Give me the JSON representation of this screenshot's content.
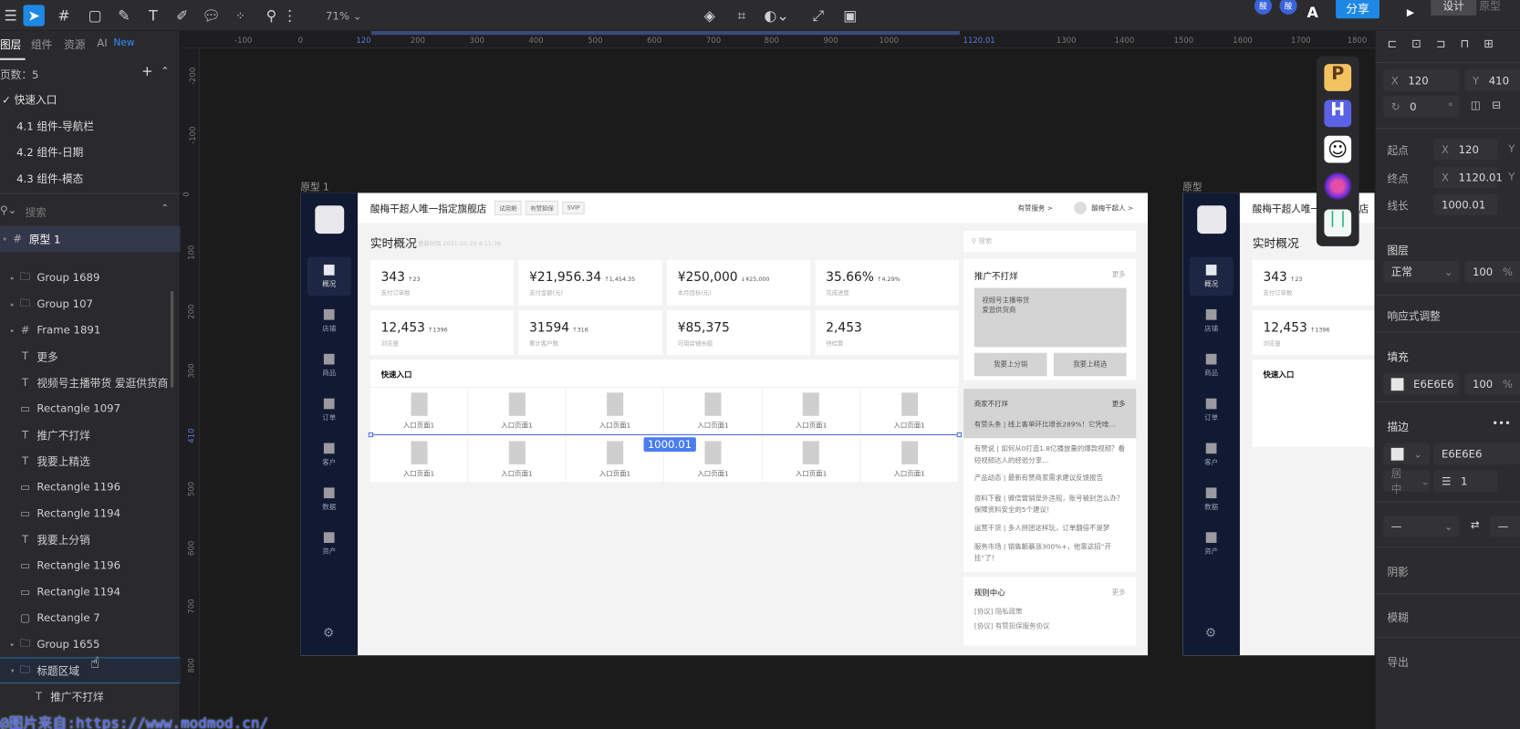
{
  "toolbar": {
    "zoom": "71%",
    "avatars": [
      "酸",
      "酸"
    ],
    "share_label": "分享",
    "mode_design": "设计",
    "mode_prototype": "原型",
    "accent": "#1e88e5"
  },
  "left_panel": {
    "tabs": [
      "图层",
      "组件",
      "资源",
      "AI"
    ],
    "ai_badge": "New",
    "pages_count_label": "页数：5",
    "pages": [
      "快速入口",
      "4.1 组件-导航栏",
      "4.2 组件-日期",
      "4.3 组件-模态"
    ],
    "search_placeholder": "搜索",
    "root_frame": "原型 1",
    "layers": [
      {
        "name": "Group 1689",
        "type": "group",
        "caret": true,
        "indent": 1
      },
      {
        "name": "Group 107",
        "type": "group",
        "caret": true,
        "indent": 1
      },
      {
        "name": "Frame 1891",
        "type": "frame",
        "caret": true,
        "indent": 1
      },
      {
        "name": "更多",
        "type": "text",
        "indent": 1
      },
      {
        "name": "视频号主播带货 爱逛供货商",
        "type": "text",
        "indent": 1
      },
      {
        "name": "Rectangle 1097",
        "type": "rect",
        "indent": 1
      },
      {
        "name": "推广不打烊",
        "type": "text",
        "indent": 1
      },
      {
        "name": "我要上精选",
        "type": "text",
        "indent": 1
      },
      {
        "name": "Rectangle 1196",
        "type": "rect",
        "indent": 1
      },
      {
        "name": "Rectangle 1194",
        "type": "rect",
        "indent": 1
      },
      {
        "name": "我要上分销",
        "type": "text",
        "indent": 1
      },
      {
        "name": "Rectangle 1196",
        "type": "rect",
        "indent": 1
      },
      {
        "name": "Rectangle 1194",
        "type": "rect",
        "indent": 1
      },
      {
        "name": "Rectangle 7",
        "type": "square",
        "indent": 1
      },
      {
        "name": "Group 1655",
        "type": "group",
        "caret": true,
        "indent": 1
      },
      {
        "name": "标题区域",
        "type": "group",
        "caret": true,
        "open": true,
        "indent": 1
      },
      {
        "name": "推广不打烊",
        "type": "text",
        "indent": 2
      }
    ]
  },
  "rulers": {
    "horizontal": [
      "-100",
      "0",
      "120",
      "200",
      "300",
      "400",
      "500",
      "600",
      "700",
      "800",
      "900",
      "1000",
      "1120.01",
      "1300",
      "1400",
      "1500",
      "1600",
      "1700",
      "1800"
    ],
    "vertical": [
      "-200",
      "-100",
      "0",
      "100",
      "200",
      "300",
      "410",
      "500",
      "600",
      "700",
      "800"
    ]
  },
  "canvas": {
    "frame1_label": "原型 1",
    "frame2_label": "原型",
    "measure_label": "1000.01",
    "store_name": "酸梅干超人唯一指定旗舰店",
    "tags": [
      "试用期",
      "有赞担保",
      "SVIP"
    ],
    "service_link": "有赞服务 >",
    "user_name": "酸梅干超人 >",
    "nav": [
      "概况",
      "店铺",
      "商品",
      "订单",
      "客户",
      "数据",
      "资产"
    ],
    "overview_title": "实时概况",
    "update_time": "更新时间 2021-10-20 4:11:36",
    "stats": [
      {
        "value": "343",
        "delta": "↑23",
        "label": "支付订单数"
      },
      {
        "value": "¥21,956.34",
        "delta": "↑1,454.35",
        "label": "支付金额(元)"
      },
      {
        "value": "¥250,000",
        "delta": "↓¥25,000",
        "label": "本月目标(元)"
      },
      {
        "value": "35.66%",
        "delta": "↑4.29%",
        "label": "完成进度"
      },
      {
        "value": "12,453",
        "delta": "↑1396",
        "label": "浏览量"
      },
      {
        "value": "31594",
        "delta": "↑316",
        "label": "累计客户数"
      },
      {
        "value": "¥85,375",
        "delta": "",
        "label": "可用店铺余额"
      },
      {
        "value": "2,453",
        "delta": "",
        "label": "待结算"
      }
    ],
    "quick_entry_title": "快速入口",
    "entries": [
      "入口页面1",
      "入口页面1",
      "入口页面1",
      "入口页面1",
      "入口页面1",
      "入口页面1",
      "入口页面1",
      "入口页面1",
      "入口页面1",
      "入口页面1",
      "入口页面1",
      "入口页面1"
    ],
    "search_placeholder": "搜索",
    "promo": {
      "title": "推广不打烊",
      "more": "更多",
      "banner_line1": "视频号主播带货",
      "banner_line2": "爱逛供货商",
      "btn1": "我要上分销",
      "btn2": "我要上精选"
    },
    "merchant": {
      "title": "商家不打烊",
      "more": "更多",
      "items": [
        "有赞头条 | 线上客单环比增长289%！它凭啥…",
        "有赞说 | 如何从0打造1.8亿播放量的爆款视频？看短视频达人的经验分享…",
        "产品动态 | 最新有赞商家需求建议反馈报告",
        "资料下载 | 微信营销是外违规，账号被封怎么办？保障资料安全的5个建议！",
        "运营干货 | 多人拼团这样玩，订单翻倍不是梦",
        "服务市场 | 销售额暴涨300%+，他靠这招“开挂”了！"
      ]
    },
    "rules": {
      "title": "规则中心",
      "more": "更多",
      "items": [
        "[协议] 隐私政策",
        "[协议] 有赞担保服务协议"
      ]
    }
  },
  "plugins": [
    "plugin-p-icon",
    "plugin-h-icon",
    "plugin-smiley-icon",
    "plugin-orbit-icon",
    "plugin-green-icon"
  ],
  "right_panel": {
    "x_label": "X",
    "x": "120",
    "y_label": "Y",
    "y": "410",
    "rotation": "0",
    "degree": "°",
    "start_label": "起点",
    "start_x": "120",
    "end_label": "终点",
    "end_x": "1120.01",
    "length_label": "线长",
    "length": "1000.01",
    "layer_title": "图层",
    "blend_mode": "正常",
    "layer_opacity": "100",
    "percent": "%",
    "responsive": "响应式调整",
    "fill_title": "填充",
    "fill_color": "E6E6E6",
    "fill_opacity": "100",
    "stroke_title": "描边",
    "stroke_color": "E6E6E6",
    "stroke_align": "居中",
    "stroke_width": "1",
    "line_end": "—",
    "shadow": "阴影",
    "blur": "模糊",
    "export": "导出"
  },
  "watermark": "@图片来自:https://www.modmod.cn/"
}
